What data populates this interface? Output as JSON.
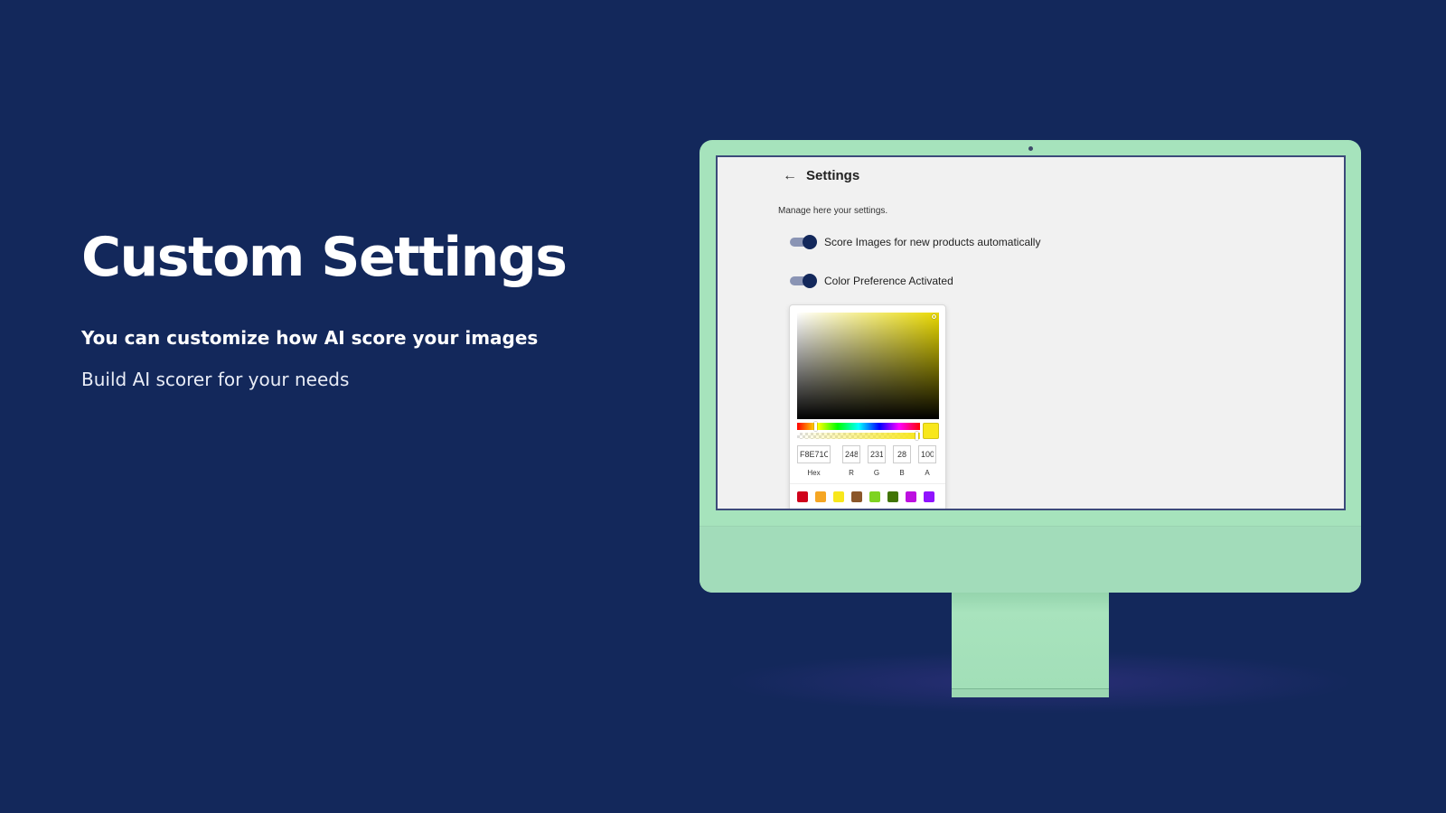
{
  "hero": {
    "title": "Custom Settings",
    "subtitle": "You can customize how AI score your images",
    "tagline": "Build AI scorer for your needs"
  },
  "settings": {
    "back_icon": "←",
    "title": "Settings",
    "description": "Manage here your settings.",
    "toggles": [
      {
        "label": "Score Images for new products automatically",
        "on": true
      },
      {
        "label": "Color Preference Activated",
        "on": true
      }
    ]
  },
  "color_picker": {
    "selected_color": "#F8E71C",
    "hex": {
      "value": "F8E71C",
      "label": "Hex"
    },
    "r": {
      "value": "248",
      "label": "R"
    },
    "g": {
      "value": "231",
      "label": "G"
    },
    "b": {
      "value": "28",
      "label": "B"
    },
    "a": {
      "value": "100",
      "label": "A"
    },
    "presets": [
      "#D0021B",
      "#F5A623",
      "#F8E71C",
      "#8B572A",
      "#7ED321",
      "#417505",
      "#BD10E0",
      "#9013FE"
    ]
  },
  "colors": {
    "background": "#13285b",
    "monitor_body": "#a6e3bc",
    "toggle_on": "#13285b"
  }
}
